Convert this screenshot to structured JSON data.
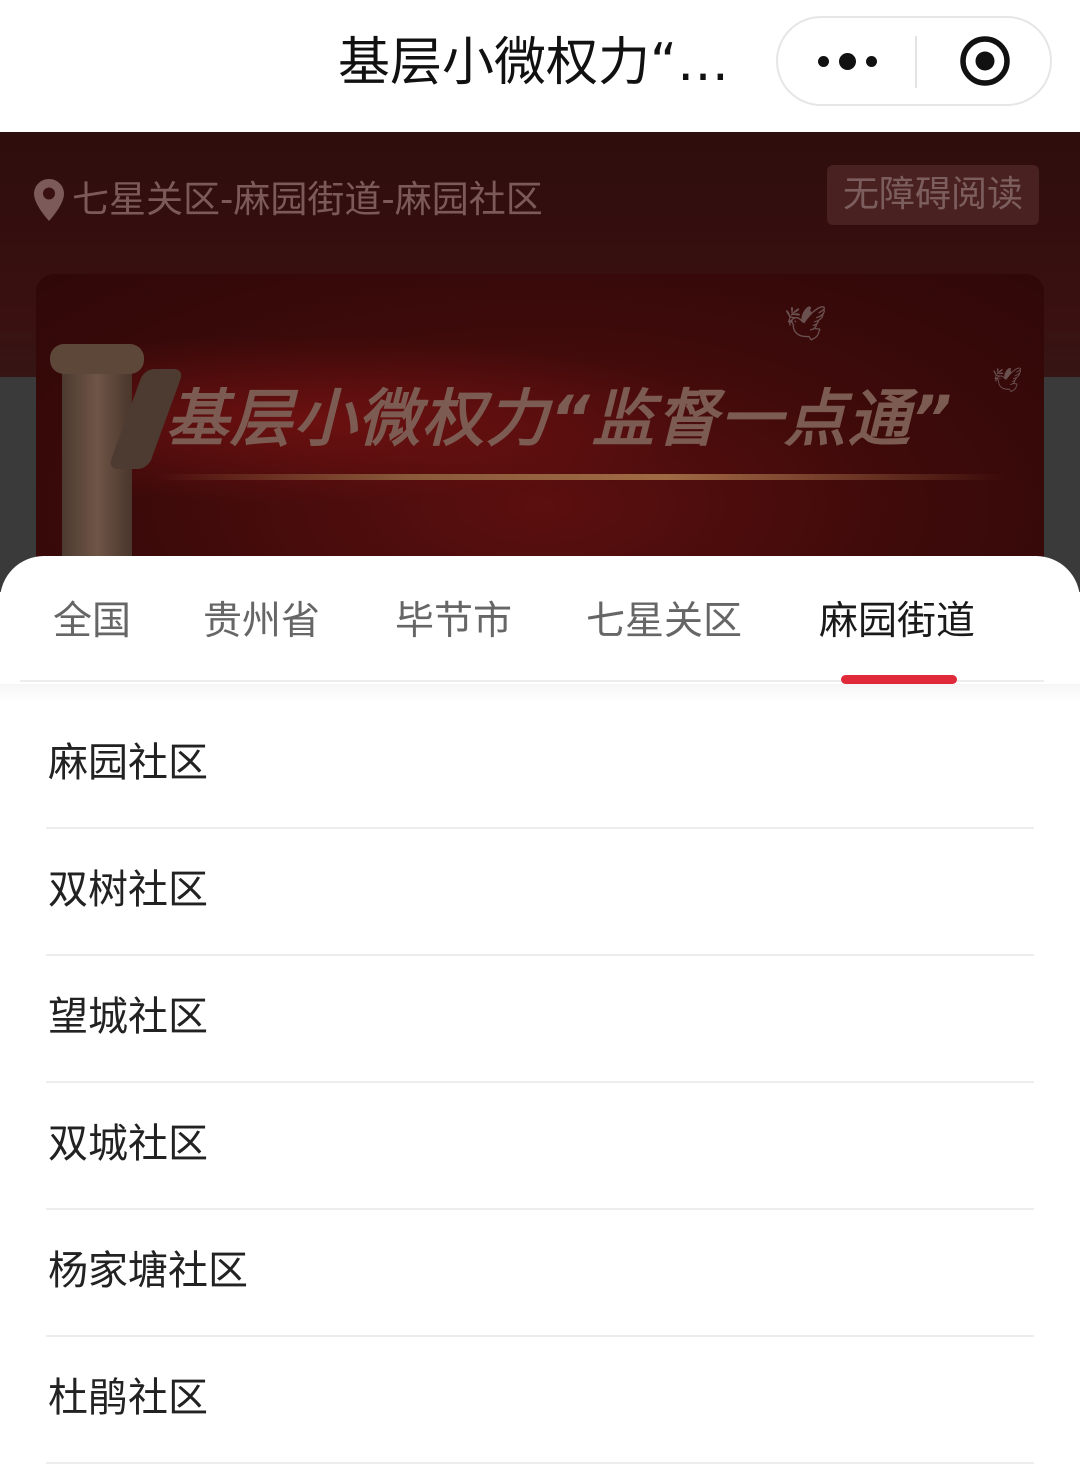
{
  "navbar": {
    "title": "基层小微权力“…",
    "more_icon": "more-dots-icon",
    "close_icon": "record-circle-icon"
  },
  "background_page": {
    "location_icon": "map-pin-icon",
    "location": "七星关区-麻园街道-麻园社区",
    "accessibility_button": "无障碍阅读",
    "banner_title": "基层小微权力“监督一点通”"
  },
  "tabs": [
    {
      "label": "全国",
      "active": false
    },
    {
      "label": "贵州省",
      "active": false
    },
    {
      "label": "毕节市",
      "active": false
    },
    {
      "label": "七星关区",
      "active": false
    },
    {
      "label": "麻园街道",
      "active": true
    }
  ],
  "communities": [
    {
      "label": "麻园社区"
    },
    {
      "label": "双树社区"
    },
    {
      "label": "望城社区"
    },
    {
      "label": "双城社区"
    },
    {
      "label": "杨家塘社区"
    },
    {
      "label": "杜鹃社区"
    }
  ],
  "colors": {
    "accent": "#e02a3a",
    "overlay_red": "#3a1010",
    "text_primary": "#222222",
    "text_secondary": "#666666"
  }
}
